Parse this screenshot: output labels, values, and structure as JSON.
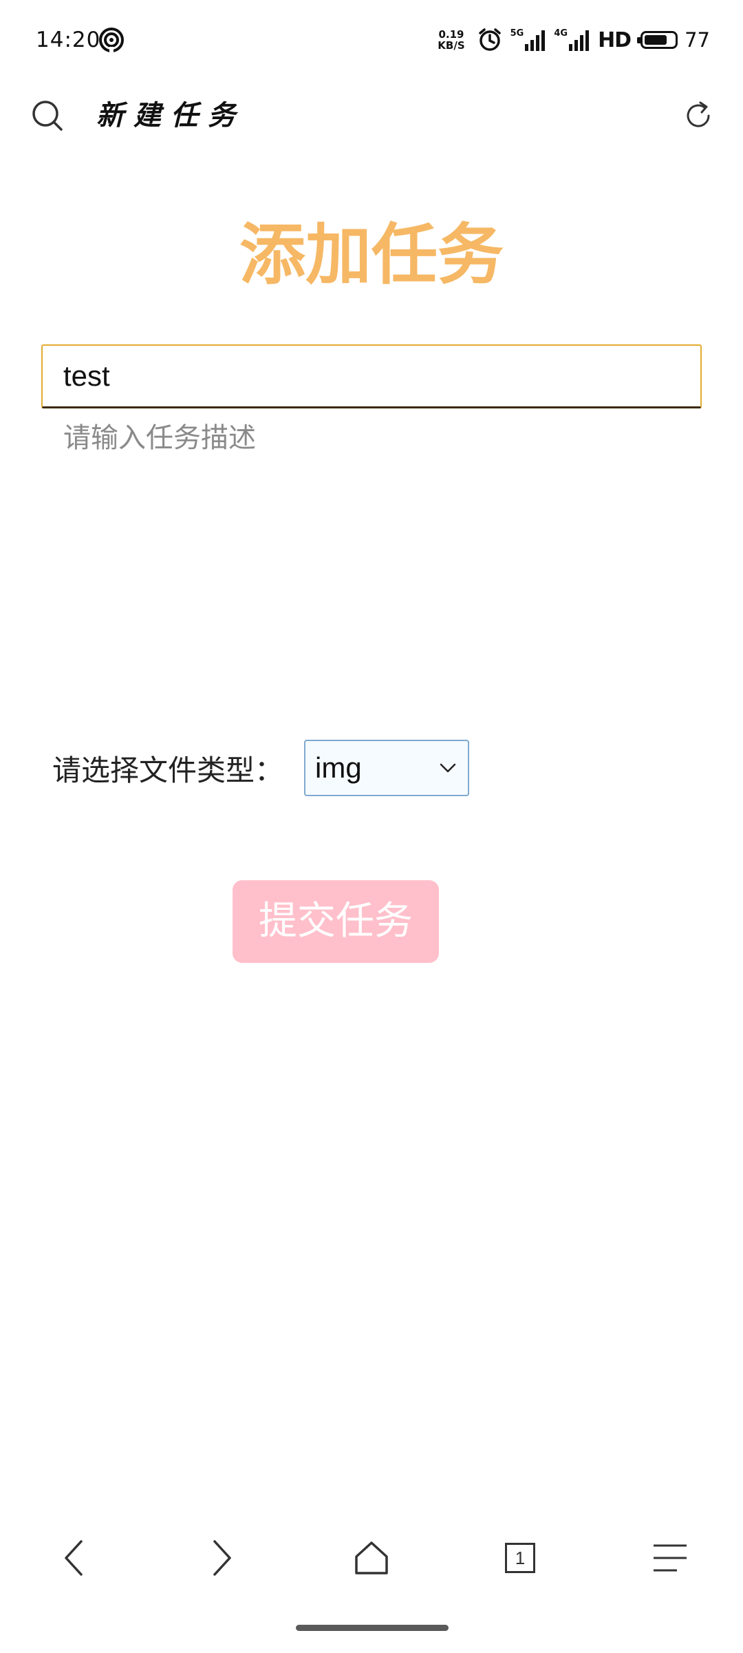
{
  "status_bar": {
    "time": "14:20",
    "net_speed_value": "0.19",
    "net_speed_unit": "KB/S",
    "signal_1_label": "5G",
    "signal_2_label": "4G",
    "hd_label": "HD",
    "battery_level": "77",
    "battery_fraction": 0.77
  },
  "header": {
    "title": "新建任务",
    "search_icon": "search-icon",
    "refresh_icon": "refresh-icon"
  },
  "main": {
    "heading": "添加任务",
    "task_name_value": "test",
    "task_desc_placeholder": "请输入任务描述",
    "filetype_label": "请选择文件类型：",
    "filetype_selected": "img",
    "submit_label": "提交任务"
  },
  "bottom_nav": {
    "items": [
      "back-icon",
      "forward-icon",
      "home-icon",
      "tabs-icon",
      "menu-icon"
    ],
    "tab_count": "1"
  },
  "colors": {
    "heading": "#f6b865",
    "submit_bg": "#ffc0cb",
    "input_border": "#e4ac30",
    "select_border": "#7fa8cf"
  }
}
